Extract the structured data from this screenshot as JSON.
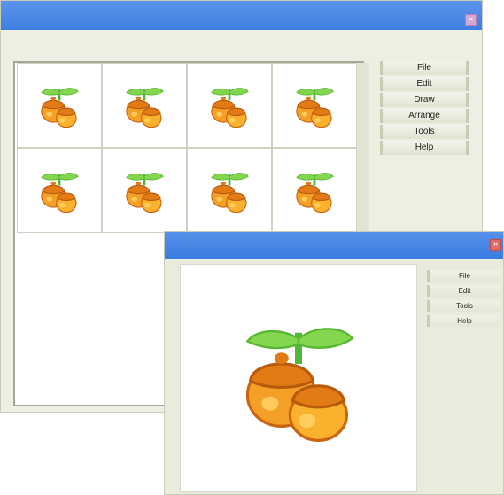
{
  "window_back": {
    "menu": [
      "File",
      "Edit",
      "Draw",
      "Arrange",
      "Tools",
      "Help"
    ],
    "thumbnails": [
      {
        "icon": "acorn-sprout-icon"
      },
      {
        "icon": "acorn-sprout-icon"
      },
      {
        "icon": "acorn-sprout-icon"
      },
      {
        "icon": "acorn-sprout-icon"
      },
      {
        "icon": "acorn-sprout-icon"
      },
      {
        "icon": "acorn-sprout-icon"
      },
      {
        "icon": "acorn-sprout-icon"
      },
      {
        "icon": "acorn-sprout-icon"
      }
    ]
  },
  "window_front": {
    "menu": [
      "File",
      "Edit",
      "Tools",
      "Help"
    ],
    "preview_icon": "acorn-sprout-icon"
  },
  "colors": {
    "titlebar": "#3f7ee1",
    "window_body": "#e9ebdd",
    "acorn": "#f08a1a",
    "leaf": "#7ad24a"
  }
}
